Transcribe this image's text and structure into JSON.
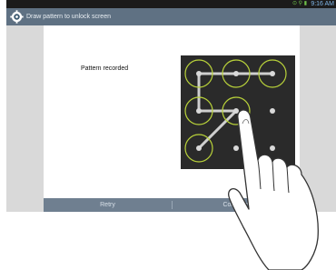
{
  "status_bar": {
    "time": "9:16 AM",
    "icons": "⊙ ⚲ ▮"
  },
  "title_bar": {
    "title": "Draw pattern to unlock screen",
    "icon": "gear-icon"
  },
  "message": "Pattern recorded",
  "pattern_grid": {
    "rows": 3,
    "cols": 3,
    "selected_dots": [
      1,
      2,
      3,
      4,
      5,
      7
    ],
    "path_order": [
      3,
      2,
      1,
      4,
      5,
      7
    ]
  },
  "buttons": {
    "retry": "Retry",
    "continue": "Continue"
  },
  "colors": {
    "title_bar": "#5f7183",
    "pattern_bg": "#2a2a2a",
    "ring": "#b9d23a",
    "line": "#cfcfcf",
    "bottom_bar": "#6f7f90"
  }
}
